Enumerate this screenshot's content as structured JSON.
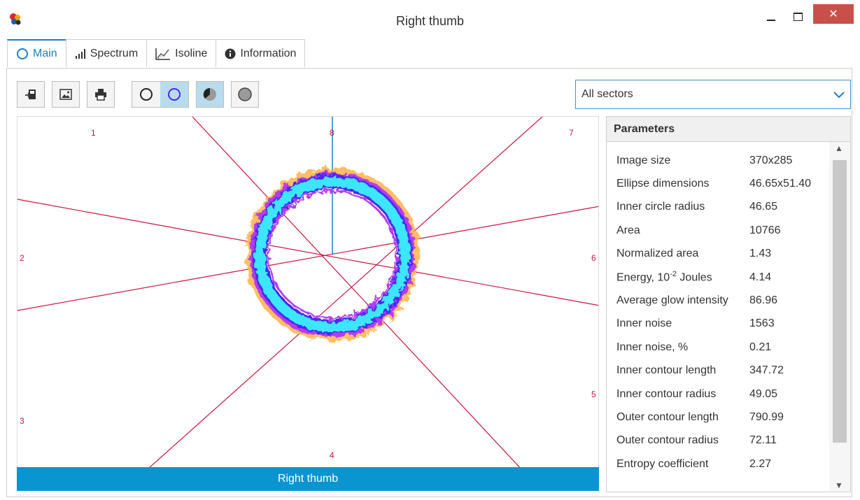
{
  "window": {
    "title": "Right thumb",
    "close_label": "✕"
  },
  "tabs": [
    {
      "label": "Main",
      "active": true
    },
    {
      "label": "Spectrum",
      "active": false
    },
    {
      "label": "Isoline",
      "active": false
    },
    {
      "label": "Information",
      "active": false
    }
  ],
  "toolbar": {
    "icons": [
      "export-icon",
      "image-icon",
      "print-icon",
      "circle-outline-icon",
      "circle-blue-outline-icon",
      "sector-fill-icon",
      "circle-gray-icon"
    ]
  },
  "sector_select": {
    "value": "All sectors"
  },
  "image_view": {
    "sector_labels": [
      "1",
      "2",
      "3",
      "4",
      "5",
      "6",
      "7",
      "8"
    ],
    "caption": "Right thumb"
  },
  "parameters": {
    "title": "Parameters",
    "rows": [
      {
        "label": "Image size",
        "value": "370x285"
      },
      {
        "label": "Ellipse dimensions",
        "value": "46.65x51.40"
      },
      {
        "label": "Inner circle radius",
        "value": "46.65"
      },
      {
        "label": "Area",
        "value": "10766"
      },
      {
        "label": "Normalized area",
        "value": "1.43"
      },
      {
        "label": "Energy, 10",
        "label_sup": "-2",
        "label_suffix": " Joules",
        "value": "4.14"
      },
      {
        "label": "Average glow intensity",
        "value": "86.96"
      },
      {
        "label": "Inner noise",
        "value": "1563"
      },
      {
        "label": "Inner noise, %",
        "value": "0.21"
      },
      {
        "label": "Inner contour length",
        "value": "347.72"
      },
      {
        "label": "Inner contour radius",
        "value": "49.05"
      },
      {
        "label": "Outer contour length",
        "value": "790.99"
      },
      {
        "label": "Outer contour radius",
        "value": "72.11"
      },
      {
        "label": "Entropy coefficient",
        "value": "2.27"
      }
    ]
  },
  "colors": {
    "accent": "#1e7ec8",
    "caption_bar": "#0a94d0",
    "sector_line": "#c8143c",
    "glow_cyan": "#3ee6ff",
    "glow_blue": "#4a2cf0",
    "glow_purple": "#b43cf0",
    "glow_orange": "#ffb24a"
  }
}
